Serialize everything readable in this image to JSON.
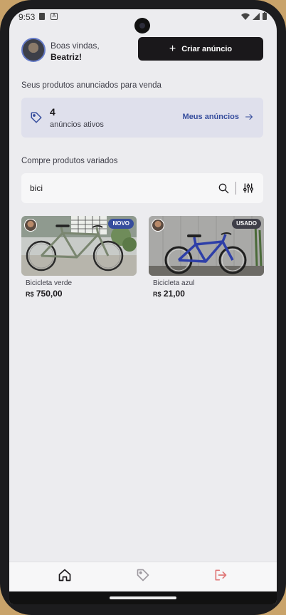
{
  "status": {
    "time": "9:53",
    "badge": "A"
  },
  "header": {
    "greeting": "Boas vindas,",
    "user_name": "Beatriz!",
    "create_button": "Criar anúncio"
  },
  "my_ads": {
    "section_title": "Seus produtos anunciados para venda",
    "count": "4",
    "label": "anúncios ativos",
    "link": "Meus anúncios"
  },
  "shop": {
    "section_title": "Compre produtos variados",
    "search_value": "bici"
  },
  "products": [
    {
      "name": "Bicicleta verde",
      "currency": "R$",
      "price": "750,00",
      "badge": "NOVO"
    },
    {
      "name": "Bicicleta azul",
      "currency": "R$",
      "price": "21,00",
      "badge": "USADO"
    }
  ],
  "nav": {
    "items": [
      "home-icon",
      "tag-icon",
      "sign-out-icon"
    ],
    "active_color": "#1a181b",
    "inactive_color": "#9f9ba1",
    "logout_color": "#e07878"
  },
  "colors": {
    "brand_blue": "#364d9d",
    "dark": "#1a181b",
    "background": "#ececef",
    "card": "#dfe0ec"
  }
}
